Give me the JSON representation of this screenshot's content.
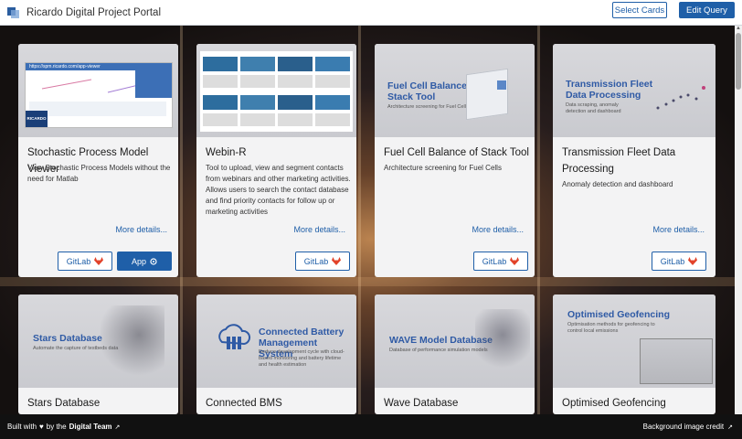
{
  "header": {
    "title": "Ricardo Digital Project Portal",
    "select_cards_label": "Select Cards",
    "edit_query_label": "Edit Query"
  },
  "cards": [
    {
      "title": "Stochastic Process Model Viewer",
      "description": "View Stochastic Process Models without the need for Matlab",
      "more_label": "More details...",
      "gitlab_label": "GitLab",
      "app_label": "App",
      "thumb_url_text": "https://spm.ricardo.com/app-viewer",
      "thumb_logo": "RICARDO"
    },
    {
      "title": "Webin-R",
      "description": "Tool to upload, view and segment contacts from webinars and other marketing activities. Allows users to search the contact database and find priority contacts for follow up or marketing activities",
      "more_label": "More details...",
      "gitlab_label": "GitLab"
    },
    {
      "title": "Fuel Cell Balance of Stack Tool",
      "description": "Architecture screening for Fuel Cells",
      "more_label": "More details...",
      "gitlab_label": "GitLab",
      "thumb_title": "Fuel Cell Balance of Stack Tool",
      "thumb_subtitle": "Architecture screening for Fuel Cells"
    },
    {
      "title": "Transmission Fleet Data Processing",
      "description": "Anomaly detection and dashboard",
      "more_label": "More details...",
      "gitlab_label": "GitLab",
      "thumb_title": "Transmission Fleet Data Processing",
      "thumb_subtitle": "Data scraping, anomaly detection and dashboard"
    },
    {
      "title": "Stars Database",
      "thumb_title": "Stars Database",
      "thumb_subtitle": "Automate the capture of testbeds data"
    },
    {
      "title": "Connected BMS",
      "thumb_title": "Connected Battery Management System",
      "thumb_subtitle": "Reduce development cycle with cloud-based monitoring and battery lifetime and health estimation"
    },
    {
      "title": "Wave Database",
      "thumb_title": "WAVE Model Database",
      "thumb_subtitle": "Database of performance simulation models"
    },
    {
      "title": "Optimised Geofencing",
      "thumb_title": "Optimised Geofencing",
      "thumb_subtitle": "Optimisation methods for geofencing to control local emissions"
    }
  ],
  "footer": {
    "built_with": "Built with",
    "by_the": "by the",
    "team": "Digital Team",
    "background_credit": "Background image credit"
  },
  "colors": {
    "primary": "#1f5fa8",
    "footer_bg": "#111111",
    "gitlab_orange": "#e2432a"
  }
}
